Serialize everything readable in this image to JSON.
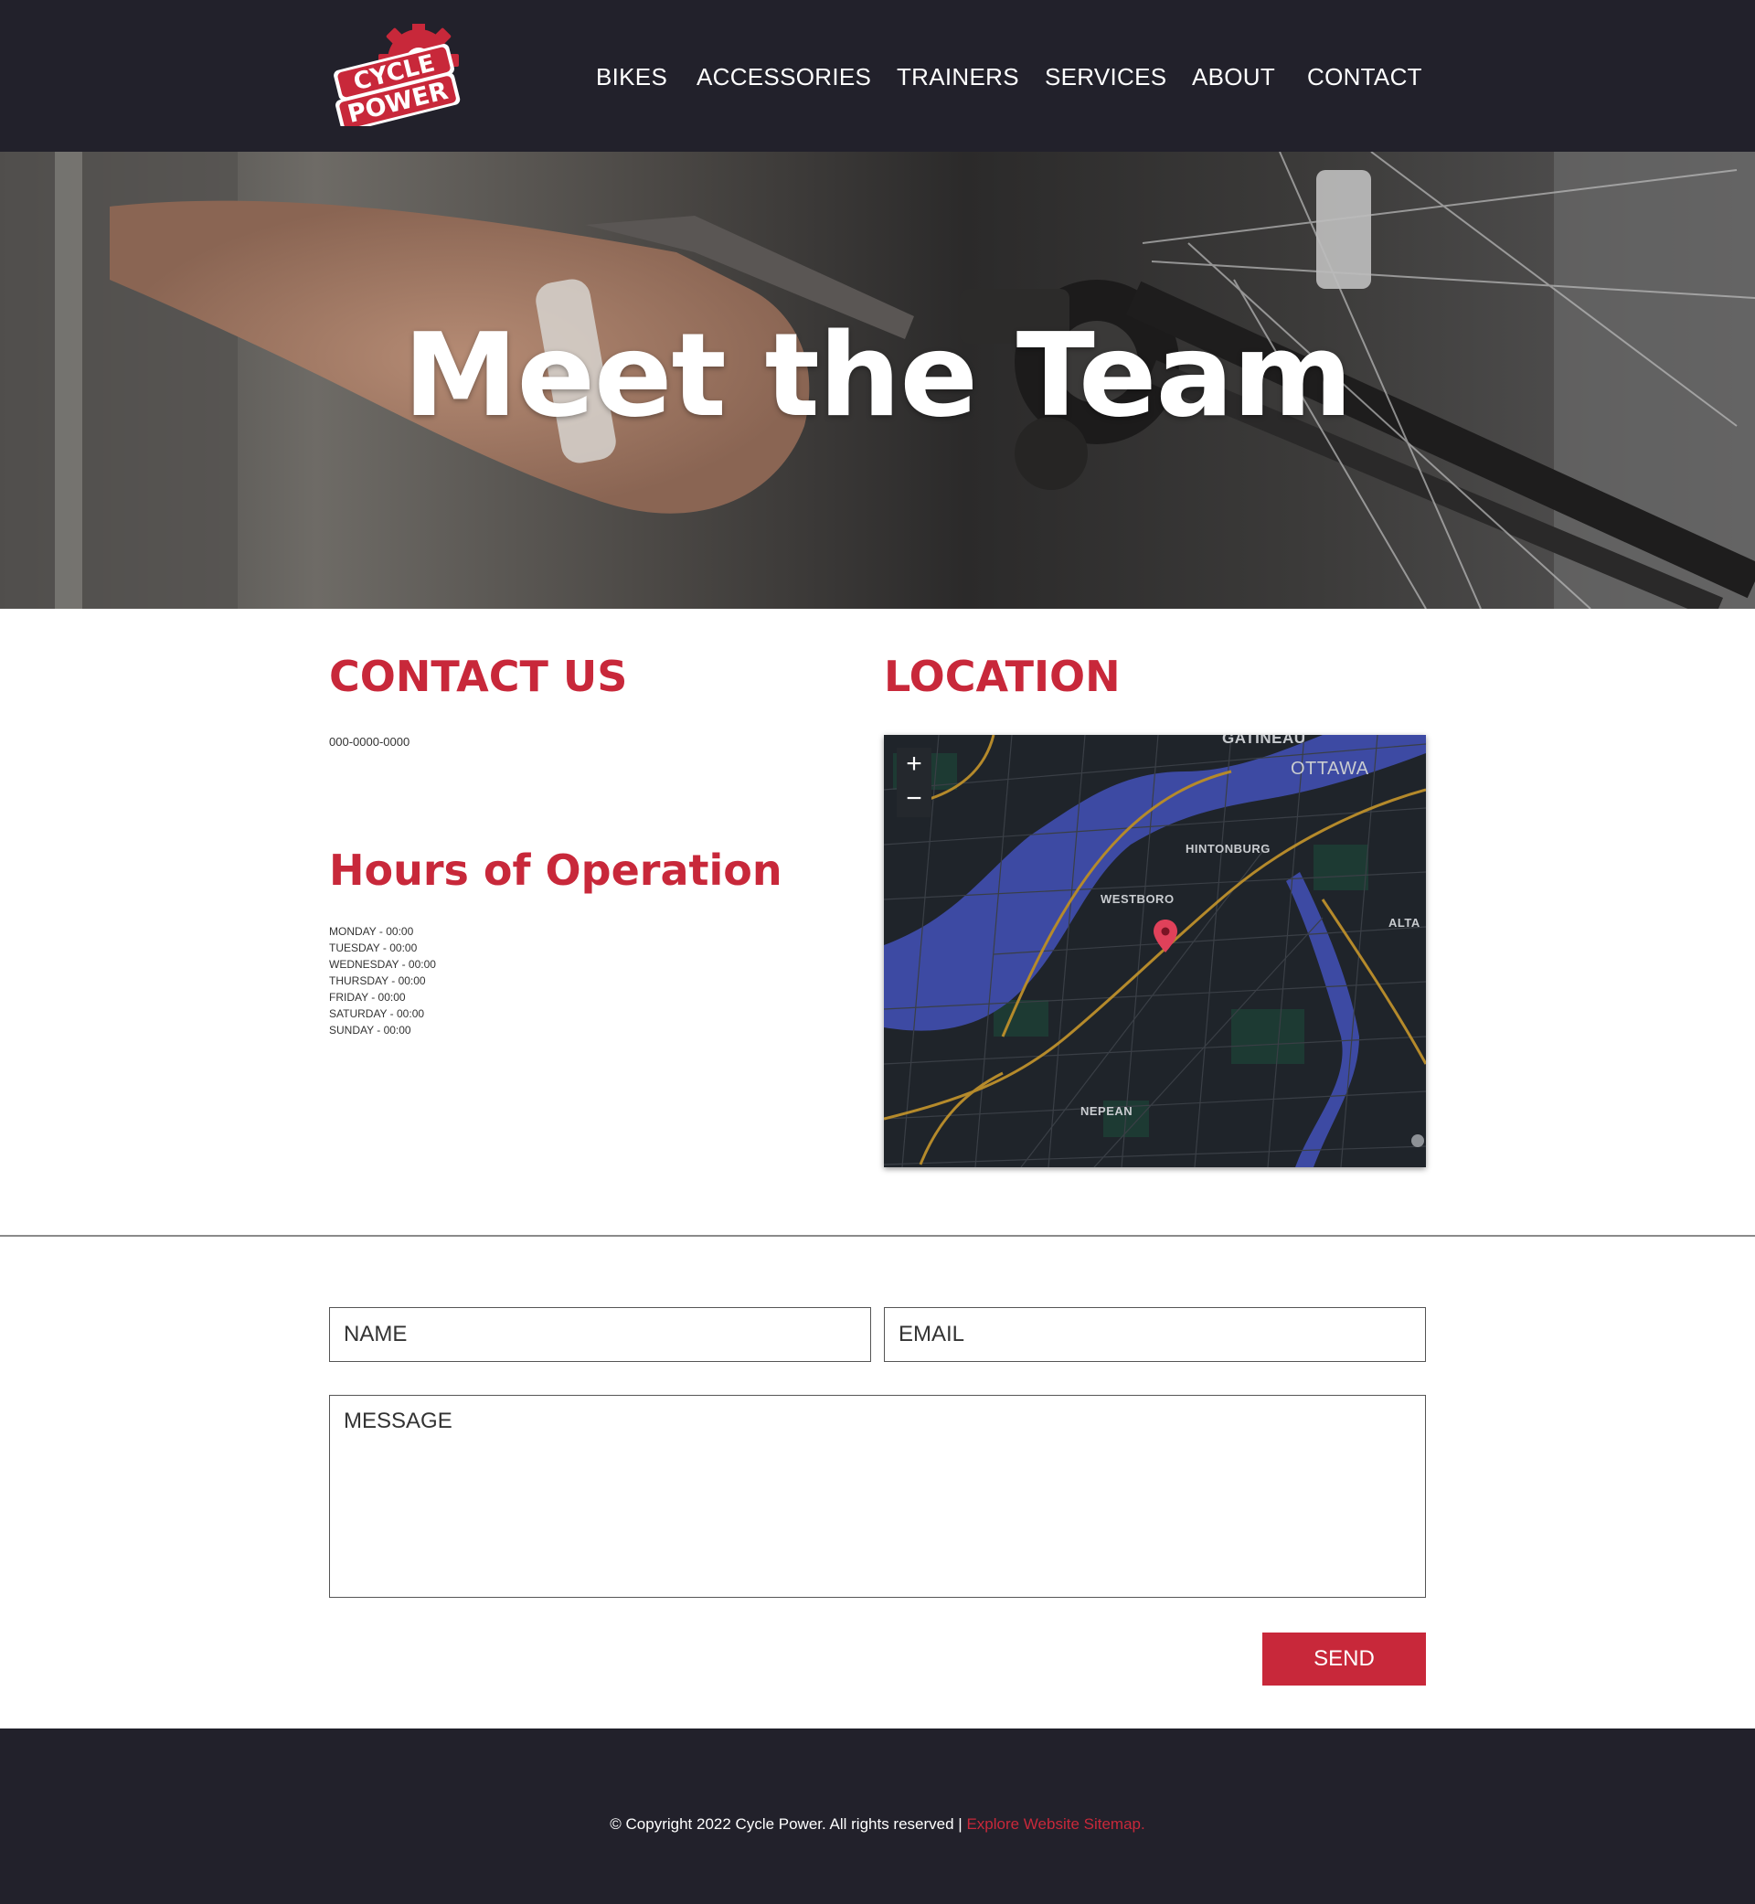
{
  "brand": {
    "logo_line1": "CYCLE",
    "logo_line2": "POWER",
    "colors": {
      "accent": "#c8283a",
      "dark": "#22212b"
    }
  },
  "nav": {
    "items": [
      {
        "label": "BIKES"
      },
      {
        "label": "ACCESSORIES"
      },
      {
        "label": "TRAINERS"
      },
      {
        "label": "SERVICES"
      },
      {
        "label": "ABOUT"
      },
      {
        "label": "CONTACT"
      }
    ]
  },
  "hero": {
    "title": "Meet the Team"
  },
  "contact": {
    "heading": "CONTACT US",
    "phone": "000-0000-0000"
  },
  "hours": {
    "heading": "Hours of Operation",
    "days": [
      "MONDAY - 00:00",
      "TUESDAY - 00:00",
      "WEDNESDAY - 00:00",
      "THURSDAY - 00:00",
      "FRIDAY - 00:00",
      "SATURDAY - 00:00",
      "SUNDAY - 00:00"
    ]
  },
  "location": {
    "heading": "LOCATION",
    "map": {
      "zoom_in": "+",
      "zoom_out": "−",
      "labels": {
        "gatineau": "GATINEAU",
        "ottawa": "OTTAWA",
        "hintonburg": "HINTONBURG",
        "westboro": "WESTBORO",
        "alta": "ALTA",
        "nepean": "NEPEAN"
      },
      "pin_icon": "map-pin-icon"
    }
  },
  "form": {
    "name_placeholder": "NAME",
    "email_placeholder": "EMAIL",
    "message_placeholder": "MESSAGE",
    "send_label": "SEND"
  },
  "footer": {
    "copyright": "© Copyright 2022 Cycle Power. All rights reserved | ",
    "sitemap_link": "Explore Website Sitemap."
  }
}
